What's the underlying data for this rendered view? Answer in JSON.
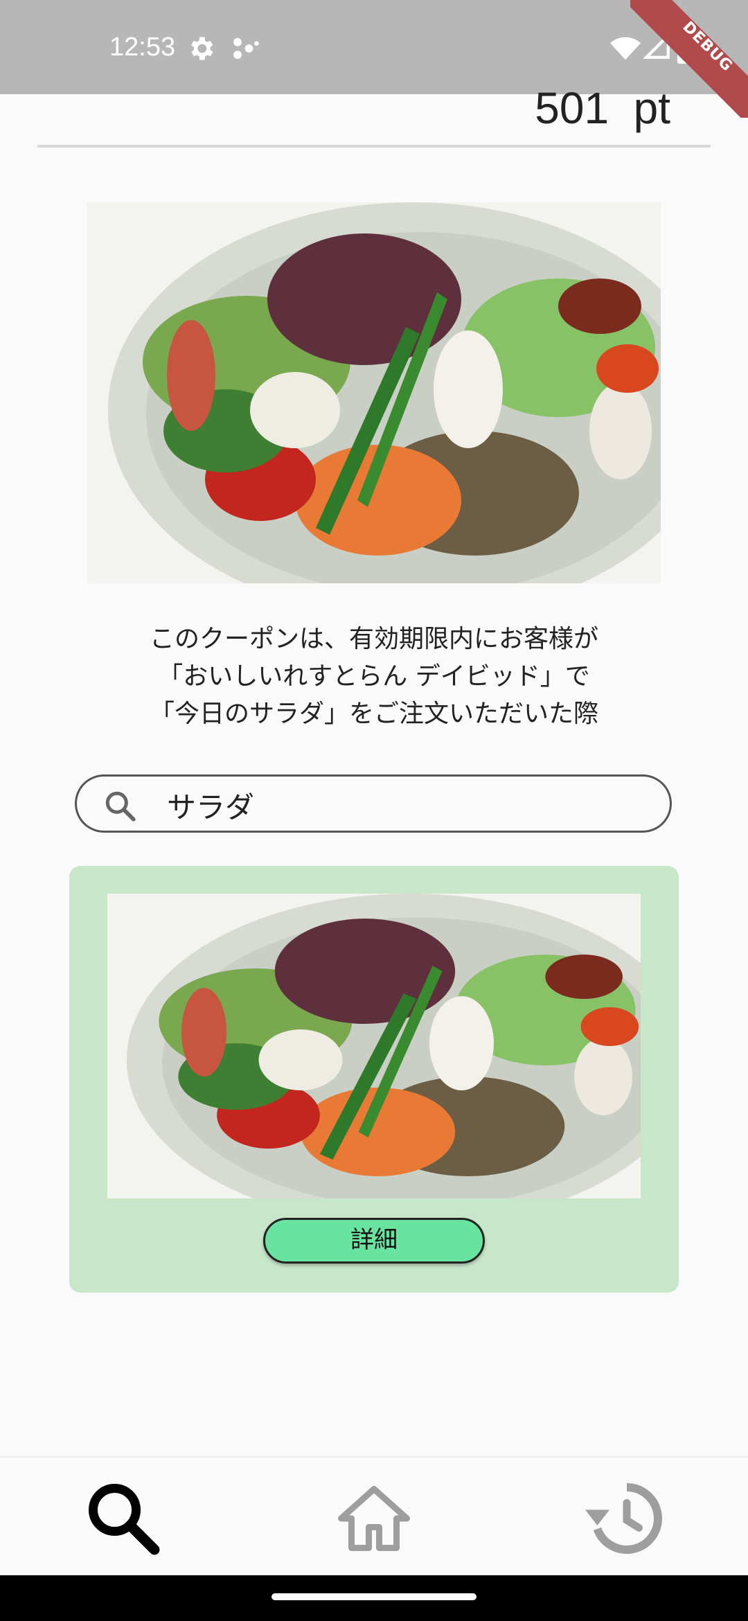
{
  "status_bar": {
    "time": "12:53",
    "icons": [
      "settings-icon",
      "dots-icon",
      "wifi-icon",
      "signal-icon",
      "battery-icon"
    ],
    "debug_label": "DEBUG"
  },
  "header": {
    "points": "501  pt"
  },
  "coupon": {
    "image_alt": "salad photo",
    "description_lines": [
      "このクーポンは、有効期限内にお客様が",
      "「おいしいれすとらん デイビッド」で",
      "「今日のサラダ」をご注文いただいた際"
    ]
  },
  "search": {
    "value": "サラダ",
    "placeholder": ""
  },
  "result_card": {
    "detail_label": "詳細",
    "background": "#c8e6c9",
    "button_color": "#69e3a0"
  },
  "bottom_nav": {
    "items": [
      {
        "icon": "search-icon",
        "active": true
      },
      {
        "icon": "home-icon",
        "active": false
      },
      {
        "icon": "history-icon",
        "active": false
      }
    ]
  }
}
